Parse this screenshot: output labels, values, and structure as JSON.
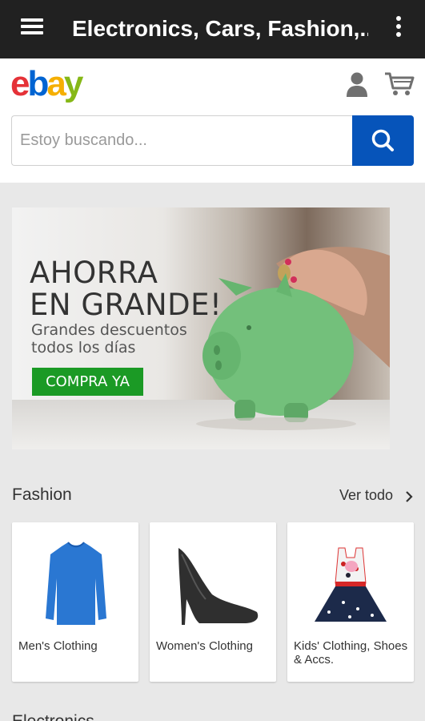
{
  "topbar": {
    "title": "Electronics, Cars, Fashion,..."
  },
  "header": {
    "logo_e": "e",
    "logo_b": "b",
    "logo_a": "a",
    "logo_y": "y"
  },
  "search": {
    "placeholder": "Estoy buscando..."
  },
  "banner": {
    "title": "AHORRA\nEN GRANDE!",
    "subtitle": "Grandes descuentos\ntodos los días",
    "cta": "COMPRA YA"
  },
  "fashion": {
    "title": "Fashion",
    "see_all": "Ver todo",
    "items": [
      {
        "label": "Men's Clothing"
      },
      {
        "label": "Women's Clothing"
      },
      {
        "label": "Kids' Clothing, Shoes & Accs."
      }
    ]
  },
  "next_section": {
    "title": "Electronics"
  },
  "colors": {
    "topbar": "#212121",
    "search_button": "#0654ba",
    "cta": "#1b9a25",
    "ebay_red": "#e53238",
    "ebay_blue": "#0064d2",
    "ebay_yellow": "#f5af02",
    "ebay_green": "#86b817"
  },
  "icons": [
    "menu-icon",
    "more-vertical-icon",
    "user-icon",
    "cart-icon",
    "search-icon",
    "chevron-right-icon"
  ]
}
